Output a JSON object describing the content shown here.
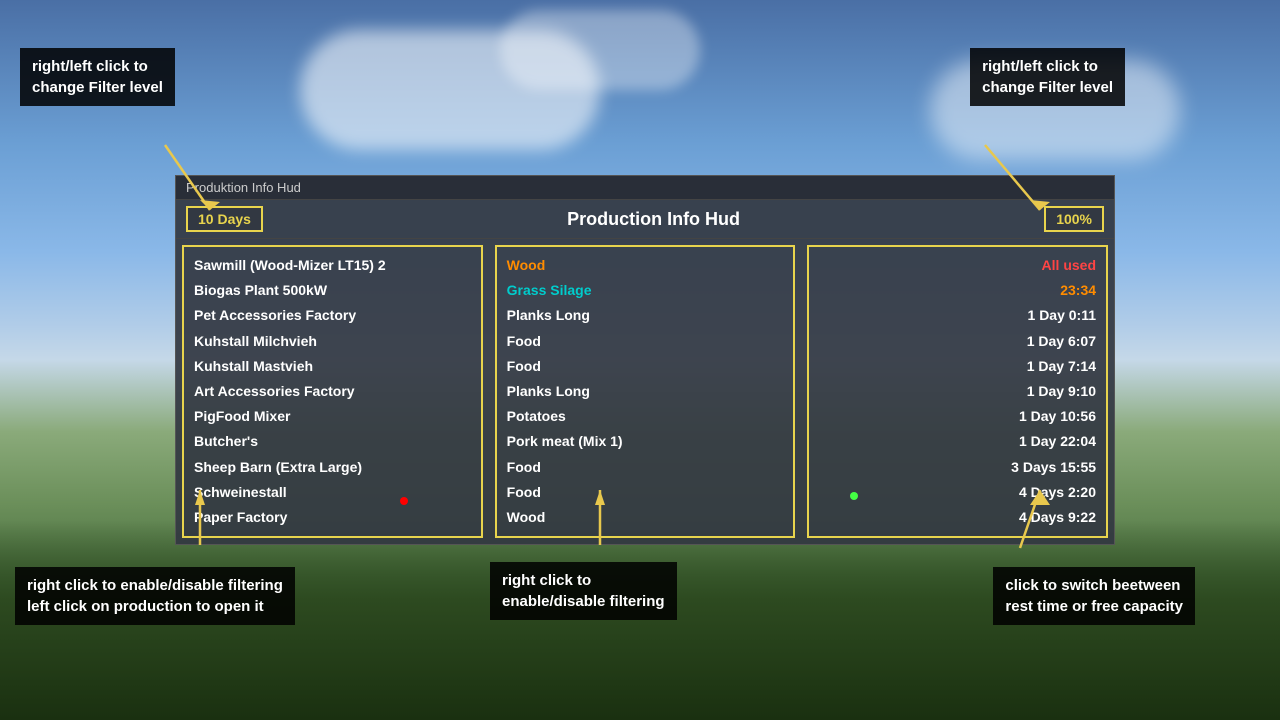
{
  "background": {
    "sky_color_top": "#4a6fa5",
    "sky_color_mid": "#8ab8e8",
    "ground_color": "#4a7040"
  },
  "hud": {
    "window_title": "Produktion Info Hud",
    "main_title": "Production Info Hud",
    "filter_days_label": "10 Days",
    "filter_pct_label": "100%",
    "productions": [
      "Sawmill (Wood-Mizer LT15) 2",
      "Biogas Plant 500kW",
      "Pet Accessories Factory",
      "Kuhstall Milchvieh",
      "Kuhstall Mastvieh",
      "Art Accessories Factory",
      "PigFood Mixer",
      "Butcher's",
      "Sheep Barn (Extra Large)",
      "Schweinestall",
      "Paper Factory"
    ],
    "outputs": [
      {
        "text": "Wood",
        "color": "orange"
      },
      {
        "text": "Grass Silage",
        "color": "cyan"
      },
      {
        "text": "Planks Long",
        "color": "white"
      },
      {
        "text": "Food",
        "color": "white"
      },
      {
        "text": "Food",
        "color": "white"
      },
      {
        "text": "Planks Long",
        "color": "white"
      },
      {
        "text": "Potatoes",
        "color": "white"
      },
      {
        "text": "Pork meat (Mix 1)",
        "color": "white"
      },
      {
        "text": "Food",
        "color": "white"
      },
      {
        "text": "Food",
        "color": "white"
      },
      {
        "text": "Wood",
        "color": "white"
      }
    ],
    "times": [
      {
        "text": "All used",
        "color": "red"
      },
      {
        "text": "23:34",
        "color": "orange"
      },
      {
        "text": "1 Day 0:11",
        "color": "white"
      },
      {
        "text": "1 Day 6:07",
        "color": "white"
      },
      {
        "text": "1 Day 7:14",
        "color": "white"
      },
      {
        "text": "1 Day 9:10",
        "color": "white"
      },
      {
        "text": "1 Day 10:56",
        "color": "white"
      },
      {
        "text": "1 Day 22:04",
        "color": "white"
      },
      {
        "text": "3 Days 15:55",
        "color": "white"
      },
      {
        "text": "4 Days 2:20",
        "color": "white"
      },
      {
        "text": "4 Days 9:22",
        "color": "white"
      }
    ]
  },
  "tooltips": {
    "top_left": {
      "line1": "right/left click to",
      "line2": "change Filter level"
    },
    "top_right": {
      "line1": "right/left click to",
      "line2": "change Filter level"
    },
    "bottom_left": {
      "line1": "right click to enable/disable filtering",
      "line2": "left click on production to open it"
    },
    "bottom_mid": {
      "line1": "right click to",
      "line2": "enable/disable filtering"
    },
    "bottom_right": {
      "line1": "click to switch beetween",
      "line2": "rest time or free capacity"
    }
  }
}
